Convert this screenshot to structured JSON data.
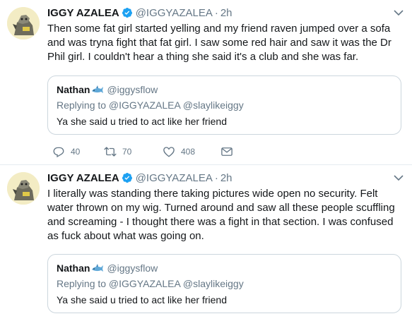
{
  "tweets": [
    {
      "author": {
        "name": "IGGY AZALEA",
        "handle": "@IGGYAZALEA",
        "time": "2h"
      },
      "text": "Then some fat girl started yelling and my friend raven jumped over a sofa and was tryna fight that fat girl. I saw some red hair and saw it was the Dr Phil girl. I couldn't hear a thing she said it's a club and she was far.",
      "quote": {
        "name": "Nathan",
        "handle": "@iggysflow",
        "replying_to": "Replying to @IGGYAZALEA @slaylikeiggy",
        "text": "Ya she said u tried to act like her friend"
      },
      "actions": {
        "replies": "40",
        "retweets": "70",
        "likes": "408"
      }
    },
    {
      "author": {
        "name": "IGGY AZALEA",
        "handle": "@IGGYAZALEA",
        "time": "2h"
      },
      "text": "I literally was standing there taking pictures wide open no security. Felt water thrown on my wig. Turned around and saw all these people scuffling and screaming - I thought there was a fight in that section. I was confused as fuck about what was going on.",
      "quote": {
        "name": "Nathan",
        "handle": "@iggysflow",
        "replying_to": "Replying to @IGGYAZALEA @slaylikeiggy",
        "text": "Ya she said u tried to act like her friend"
      }
    }
  ],
  "colors": {
    "verified": "#1da1f2",
    "muted": "#657786",
    "border": "#ccd6dd"
  },
  "icons": [
    "verified-badge-icon",
    "chevron-down-icon",
    "shark-emoji-icon",
    "reply-icon",
    "retweet-icon",
    "like-icon",
    "direct-message-icon"
  ]
}
